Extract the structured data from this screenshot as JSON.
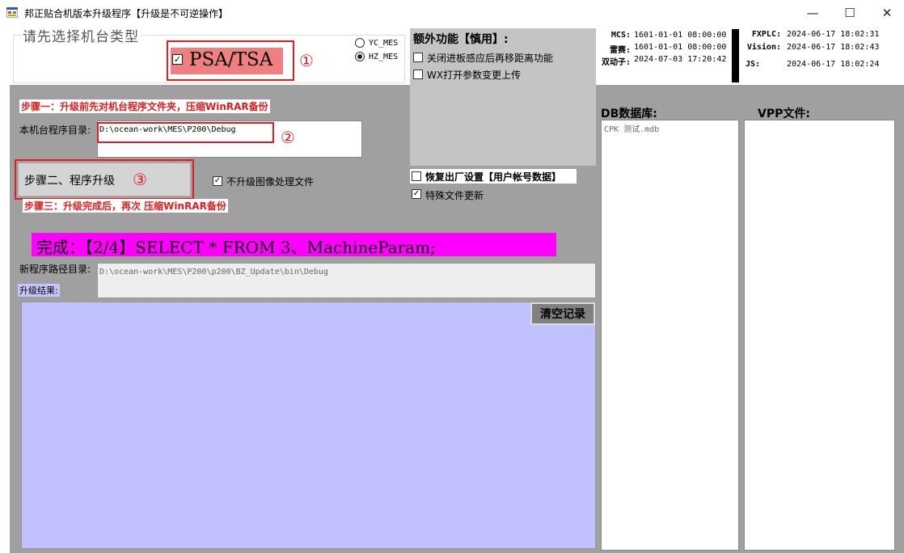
{
  "window": {
    "title": "邦正贴合机版本升级程序【升级是不可逆操作】",
    "minimize": "—",
    "maximize": "☐",
    "close": "✕"
  },
  "machine_type": {
    "group_title": "请先选择机台类型",
    "psa_tsa_label": "PSA/TSA",
    "psa_tsa_checked": true,
    "marker_1": "①",
    "radios": [
      {
        "label": "YC_MES",
        "selected": false
      },
      {
        "label": "HZ_MES",
        "selected": true
      }
    ]
  },
  "extra": {
    "title": "额外功能【慎用】:",
    "options": [
      {
        "label": "关闭进板感应后再移距离功能",
        "checked": false
      },
      {
        "label": "WX打开参数变更上传",
        "checked": false
      },
      {
        "label": "恢复出厂设置【用户帐号数据】",
        "checked": false
      },
      {
        "label": "特殊文件更新",
        "checked": true
      }
    ]
  },
  "status": {
    "left": [
      {
        "label": "MCS:",
        "value": "1601-01-01  08:00:00"
      },
      {
        "label": "雷赛:",
        "value": "1601-01-01  08:00:00"
      },
      {
        "label": "双动子:",
        "value": "2024-07-03  17:20:42"
      }
    ],
    "right": [
      {
        "label": "FXPLC:",
        "value": "2024-06-17  18:02:31"
      },
      {
        "label": "Vision:",
        "value": "2024-06-17  18:02:43"
      },
      {
        "label": "JS:",
        "value": "2024-06-17  18:02:24"
      }
    ]
  },
  "steps": {
    "step1": "步骤一：升级前先对机台程序文件夹，压缩WinRAR备份",
    "dir_label": "本机台程序目录:",
    "dir_value": "D:\\ocean-work\\MES\\P200\\Debug",
    "marker_2": "②",
    "step2_button": "步骤二、程序升级",
    "marker_3": "③",
    "no_image_label": "不升级图像处理文件",
    "no_image_checked": true,
    "step3": "步骤三：升级完成后，再次 压缩WinRAR备份"
  },
  "progress": {
    "done_text": "完成：【2/4】SELECT * FROM 3、MachineParam;"
  },
  "new_dir": {
    "label": "新程序路径目录:",
    "value": "D:\\ocean-work\\MES\\P200\\p200\\BZ_Update\\bin\\Debug"
  },
  "result": {
    "label": "升级结果:",
    "clear_button": "清空记录"
  },
  "db": {
    "title": "DB数据库:",
    "items": [
      "CPK 测试.mdb"
    ]
  },
  "vpp": {
    "title": "VPP文件:"
  }
}
